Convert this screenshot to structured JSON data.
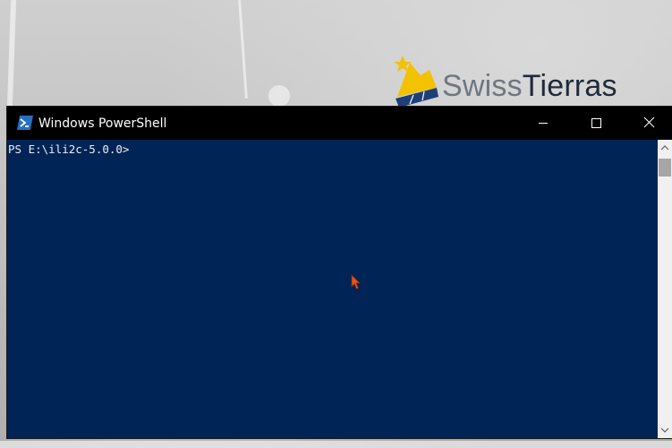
{
  "wallpaper": {
    "logo": {
      "text_part1": "Swiss",
      "text_part2": "Tierras",
      "mark_icon": "star-tile-logo-icon",
      "colors": {
        "yellow": "#f2c200",
        "navy": "#1f3f7a",
        "gray": "#6f7780",
        "dark": "#1f2a3a"
      }
    }
  },
  "window": {
    "title": "Windows PowerShell",
    "icon": "powershell-icon",
    "controls": {
      "minimize": "minimize-icon",
      "maximize": "maximize-icon",
      "close": "close-icon"
    },
    "colors": {
      "titlebar": "#000000",
      "console_bg": "#012456",
      "text": "#eeedf0"
    }
  },
  "console": {
    "prompt": "PS E:\\ili2c-5.0.0>"
  },
  "scrollbar": {
    "up": "scroll-up-arrow-icon",
    "down": "scroll-down-arrow-icon"
  },
  "pointer": {
    "icon": "mouse-pointer-icon",
    "color": "#e8541e"
  }
}
